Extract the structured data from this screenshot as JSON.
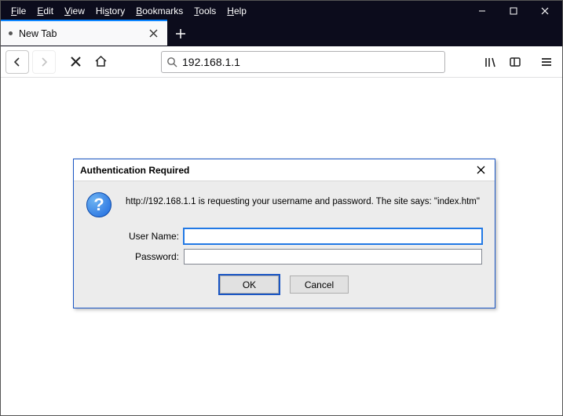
{
  "menus": {
    "file": "File",
    "edit": "Edit",
    "view": "View",
    "history": "History",
    "bookmarks": "Bookmarks",
    "tools": "Tools",
    "help": "Help"
  },
  "tab": {
    "title": "New Tab"
  },
  "urlbar": {
    "value": "192.168.1.1"
  },
  "dialog": {
    "title": "Authentication Required",
    "message": "http://192.168.1.1 is requesting your username and password. The site says: \"index.htm\"",
    "username_label": "User Name:",
    "password_label": "Password:",
    "username_value": "",
    "password_value": "",
    "ok_label": "OK",
    "cancel_label": "Cancel"
  }
}
